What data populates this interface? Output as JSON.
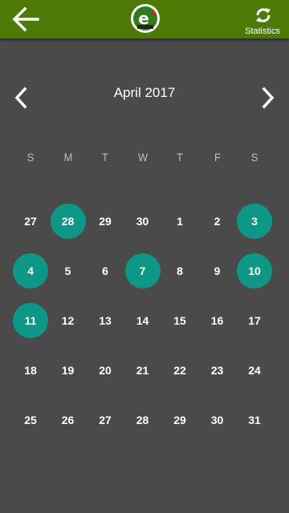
{
  "appbar": {
    "back_icon": "arrow-left-icon",
    "logo_icon": "app-logo-icon",
    "stats_icon": "refresh-icon",
    "stats_label": "Statistics"
  },
  "calendar": {
    "month_title": "April 2017",
    "prev_icon": "chevron-left-icon",
    "next_icon": "chevron-right-icon",
    "weekdays": [
      "S",
      "M",
      "T",
      "W",
      "T",
      "F",
      "S"
    ],
    "weeks": [
      [
        "27",
        "28",
        "29",
        "30",
        "1",
        "2",
        "3"
      ],
      [
        "4",
        "5",
        "6",
        "7",
        "8",
        "9",
        "10"
      ],
      [
        "11",
        "12",
        "13",
        "14",
        "15",
        "16",
        "17"
      ],
      [
        "18",
        "19",
        "20",
        "21",
        "22",
        "23",
        "24"
      ],
      [
        "25",
        "26",
        "27",
        "28",
        "29",
        "30",
        "31"
      ]
    ],
    "highlighted": [
      [
        0,
        1
      ],
      [
        0,
        6
      ],
      [
        1,
        0
      ],
      [
        1,
        3
      ],
      [
        1,
        6
      ],
      [
        2,
        0
      ]
    ],
    "highlight_color": "#0e9686"
  },
  "colors": {
    "appbar": "#4c7a05",
    "background": "#4a4a4a"
  }
}
